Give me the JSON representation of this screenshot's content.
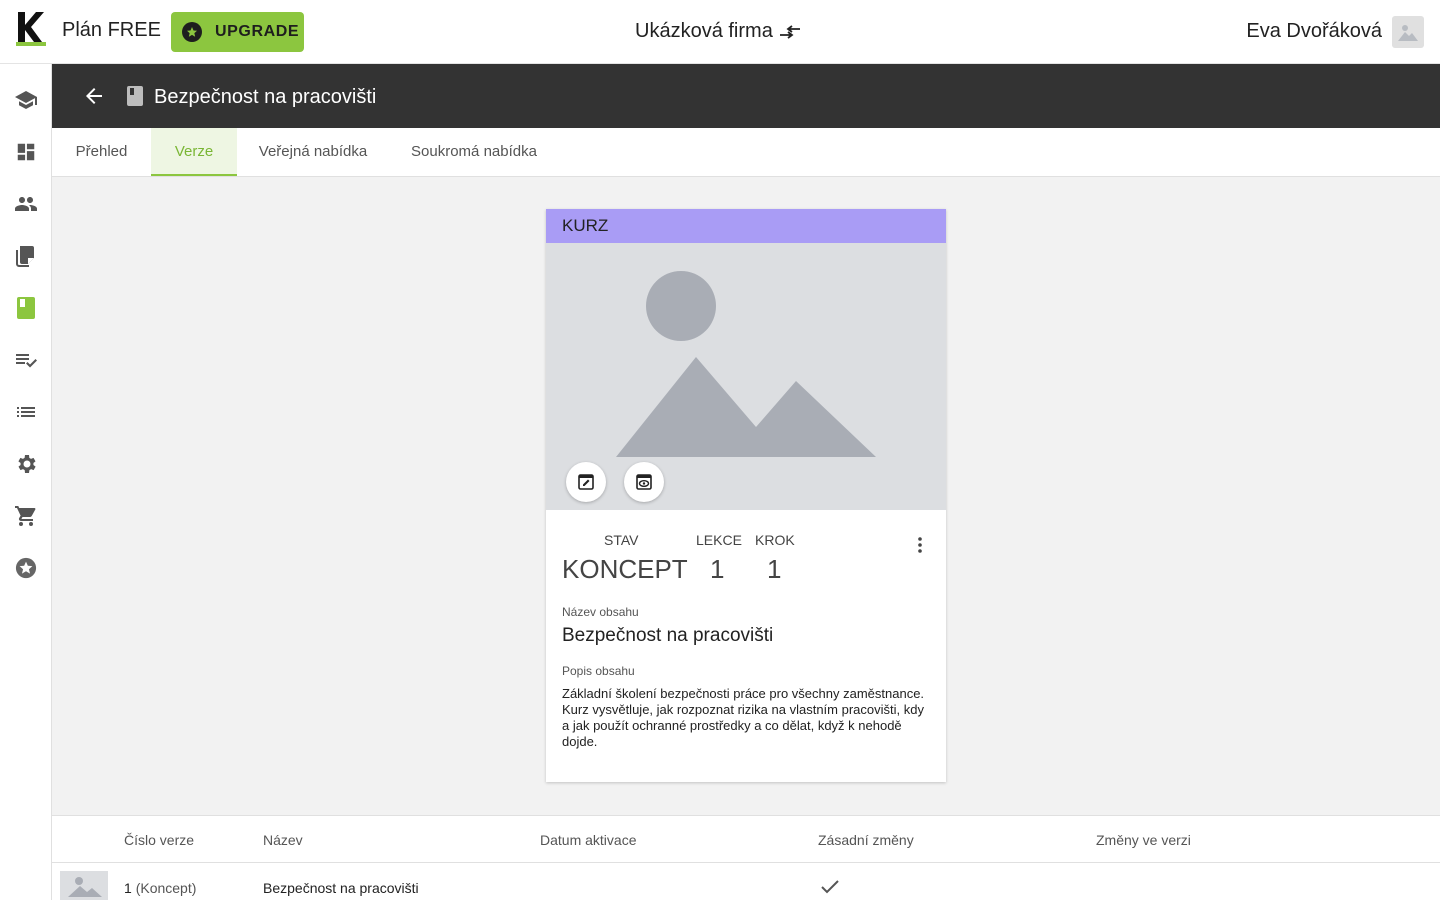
{
  "topbar": {
    "plan": "Plán FREE",
    "upgrade_label": "UPGRADE",
    "company": "Ukázková firma",
    "user": "Eva Dvořáková"
  },
  "sidebar": {
    "items": [
      "school-icon",
      "dashboard-icon",
      "people-icon",
      "library-icon",
      "book-icon",
      "checklist-icon",
      "list-icon",
      "settings-icon",
      "cart-icon",
      "star-icon"
    ],
    "active_index": 4
  },
  "header": {
    "title": "Bezpečnost na pracovišti"
  },
  "tabs": [
    {
      "label": "Přehled"
    },
    {
      "label": "Verze",
      "active": true
    },
    {
      "label": "Veřejná nabídka"
    },
    {
      "label": "Soukromá nabídka"
    }
  ],
  "card": {
    "type_label": "KURZ",
    "stav_label": "STAV",
    "stav_value": "KONCEPT",
    "lekce_label": "LEKCE",
    "lekce_value": "1",
    "krok_label": "KROK",
    "krok_value": "1",
    "name_label": "Název obsahu",
    "name_value": "Bezpečnost na pracovišti",
    "desc_label": "Popis obsahu",
    "desc_value": "Základní školení bezpečnosti práce pro všechny zaměstnance. Kurz vysvětluje, jak rozpoznat rizika na vlastním pracovišti, kdy a jak použít ochranné prostředky a co dělat, když k nehodě dojde."
  },
  "table": {
    "headers": [
      "Číslo verze",
      "Název",
      "Datum aktivace",
      "Zásadní změny",
      "Změny ve verzi"
    ],
    "rows": [
      {
        "version": "1",
        "version_note": "(Koncept)",
        "name": "Bezpečnost na pracovišti",
        "activation": "",
        "major_changes": true,
        "changes": ""
      }
    ]
  },
  "colors": {
    "accent": "#8cc63f",
    "header_bg": "#333333",
    "card_head": "#a99cf5"
  }
}
